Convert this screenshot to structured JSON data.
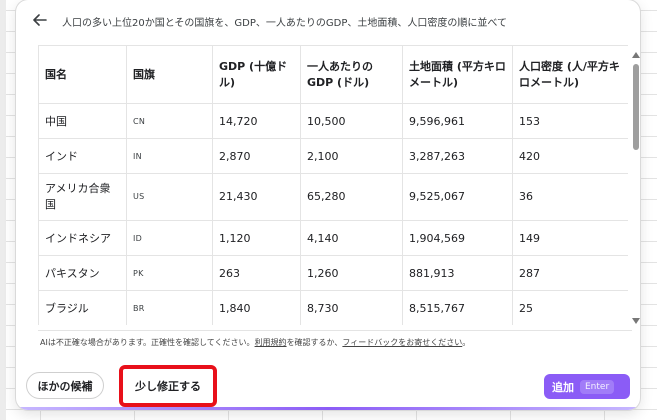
{
  "header": {
    "back_icon": "arrow-left-icon",
    "prompt": "人口の多い上位20か国とその国旗を、GDP、一人あたりのGDP、土地面積、人口密度の順に並べて"
  },
  "table": {
    "columns": [
      "国名",
      "国旗",
      "GDP (十億ドル)",
      "一人あたりの GDP (ドル)",
      "土地面積 (平方キロメートル)",
      "人口密度 (人/平方キロメートル)"
    ],
    "rows": [
      [
        "中国",
        "CN",
        "14,720",
        "10,500",
        "9,596,961",
        "153"
      ],
      [
        "インド",
        "IN",
        "2,870",
        "2,100",
        "3,287,263",
        "420"
      ],
      [
        "アメリカ合衆国",
        "US",
        "21,430",
        "65,280",
        "9,525,067",
        "36"
      ],
      [
        "インドネシア",
        "ID",
        "1,120",
        "4,140",
        "1,904,569",
        "149"
      ],
      [
        "パキスタン",
        "PK",
        "263",
        "1,260",
        "881,913",
        "287"
      ],
      [
        "ブラジル",
        "BR",
        "1,840",
        "8,730",
        "8,515,767",
        "25"
      ]
    ]
  },
  "footer": {
    "disclaimer_prefix": "AIは不正確な場合があります。正確性を確認してください。",
    "terms_link": "利用規約",
    "disclaimer_middle": "を確認するか、",
    "feedback_link": "フィードバックをお寄せください",
    "disclaimer_suffix": "。"
  },
  "actions": {
    "other_label": "ほかの候補",
    "refine_label": "少し修正する",
    "add_label": "追加",
    "add_shortcut": "Enter"
  },
  "colors": {
    "accent": "#8b5cf6",
    "highlight": "#e8101a"
  }
}
